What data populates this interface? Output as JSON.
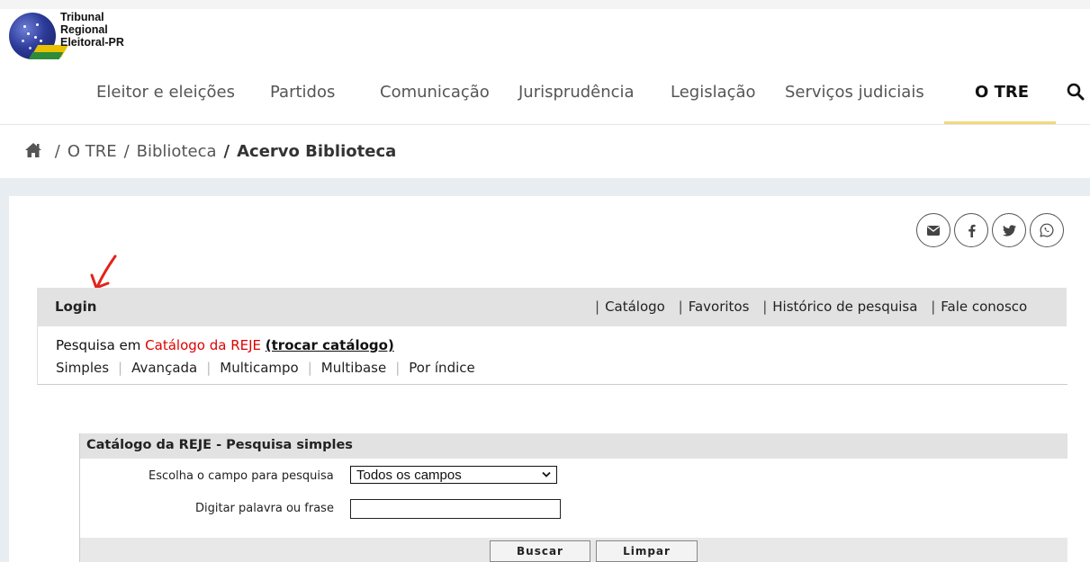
{
  "logo": {
    "line1": "Tribunal",
    "line2": "Regional",
    "line3": "Eleitoral-PR"
  },
  "nav": {
    "items": [
      "Eleitor e eleições",
      "Partidos",
      "Comunicação",
      "Jurisprudência",
      "Legislação",
      "Serviços judiciais",
      "O TRE"
    ],
    "active": "O TRE",
    "search_icon": "search-icon"
  },
  "breadcrumb": {
    "home_icon": "home-icon",
    "items": [
      "O TRE",
      "Biblioteca"
    ],
    "current": "Acervo Biblioteca",
    "separator": "/"
  },
  "share": {
    "icons": [
      "envelope-icon",
      "facebook-icon",
      "twitter-icon",
      "whatsapp-icon"
    ]
  },
  "loginbar": {
    "login": "Login",
    "links": [
      "Catálogo",
      "Favoritos",
      "Histórico de pesquisa",
      "Fale conosco"
    ],
    "pipe": "|"
  },
  "search_mode": {
    "prefix": "Pesquisa em",
    "catalog": "Catálogo da REJE",
    "change": "(trocar catálogo)",
    "modes": [
      "Simples",
      "Avançada",
      "Multicampo",
      "Multibase",
      "Por índice"
    ],
    "pipe": "|"
  },
  "simple_search": {
    "title": "Catálogo da REJE - Pesquisa simples",
    "field_label": "Escolha o campo para pesquisa",
    "field_value": "Todos os campos",
    "text_label": "Digitar palavra ou frase",
    "text_value": "",
    "search_button": "Buscar",
    "clear_button": "Limpar"
  },
  "colors": {
    "active_underline": "#f2d77e",
    "catalog_red": "#e00000",
    "band": "#e8edf2"
  }
}
